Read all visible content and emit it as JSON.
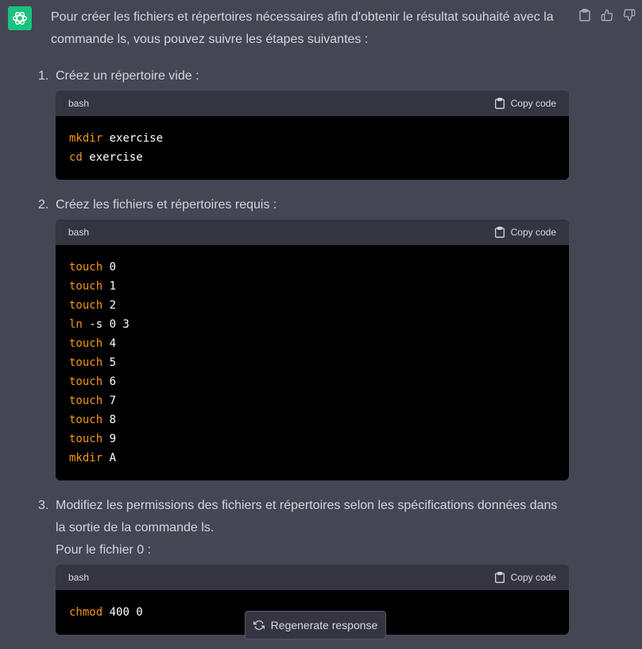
{
  "intro": "Pour créer les fichiers et répertoires nécessaires afin d'obtenir le résultat souhaité avec la commande ls, vous pouvez suivre les étapes suivantes :",
  "steps": [
    {
      "number": "1.",
      "text": "Créez un répertoire vide :",
      "code": {
        "lang": "bash",
        "copy_label": "Copy code",
        "lines": [
          {
            "cmd": "mkdir",
            "args": " exercise"
          },
          {
            "cmd": "cd",
            "args": " exercise"
          }
        ]
      }
    },
    {
      "number": "2.",
      "text": "Créez les fichiers et répertoires requis :",
      "code": {
        "lang": "bash",
        "copy_label": "Copy code",
        "lines": [
          {
            "cmd": "touch",
            "args": " 0"
          },
          {
            "cmd": "touch",
            "args": " 1"
          },
          {
            "cmd": "touch",
            "args": " 2"
          },
          {
            "cmd": "ln",
            "args": " -s 0 3"
          },
          {
            "cmd": "touch",
            "args": " 4"
          },
          {
            "cmd": "touch",
            "args": " 5"
          },
          {
            "cmd": "touch",
            "args": " 6"
          },
          {
            "cmd": "touch",
            "args": " 7"
          },
          {
            "cmd": "touch",
            "args": " 8"
          },
          {
            "cmd": "touch",
            "args": " 9"
          },
          {
            "cmd": "mkdir",
            "args": " A"
          }
        ]
      }
    },
    {
      "number": "3.",
      "text": "Modifiez les permissions des fichiers et répertoires selon les spécifications données dans la sortie de la commande ls.",
      "subtext": "Pour le fichier 0 :",
      "code": {
        "lang": "bash",
        "copy_label": "Copy code",
        "lines": [
          {
            "cmd": "chmod",
            "args": " 400 0"
          }
        ]
      }
    }
  ],
  "regenerate_label": "Regenerate response",
  "colors": {
    "background": "#444654",
    "accent": "#19c37d",
    "command": "#f29718"
  },
  "icons": [
    "openai-logo-icon",
    "clipboard-icon",
    "thumbs-up-icon",
    "thumbs-down-icon",
    "refresh-icon"
  ]
}
